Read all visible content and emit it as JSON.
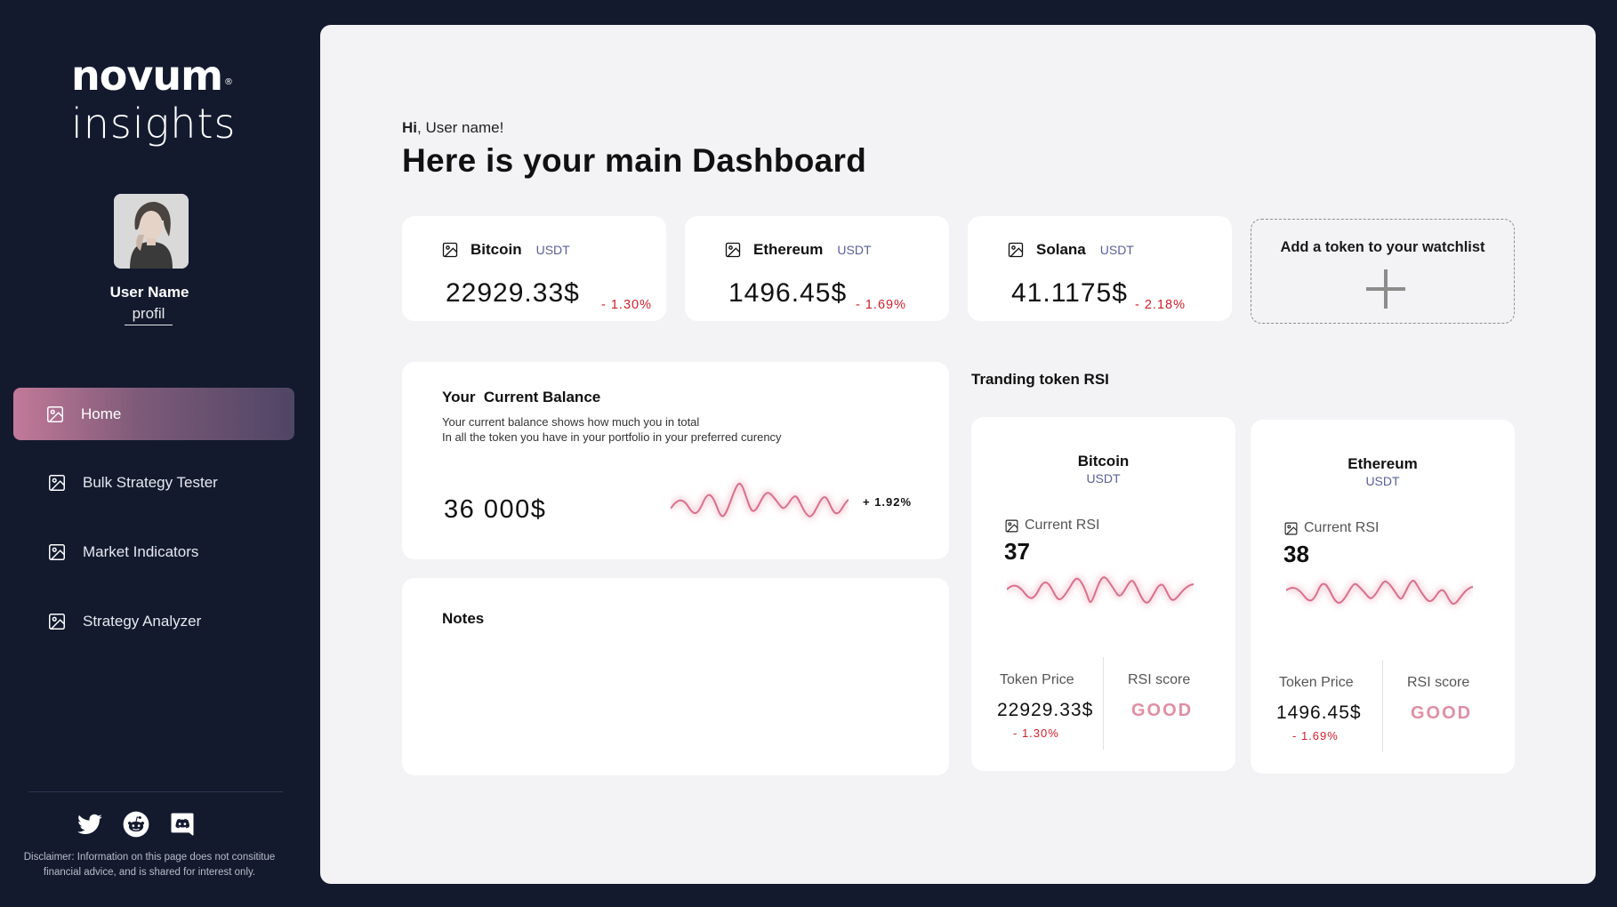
{
  "sidebar": {
    "logo_top": "novum",
    "logo_mark": "®",
    "logo_bottom": "insights",
    "user_name": "User Name",
    "profile_link": "profil",
    "nav": [
      {
        "label": "Home",
        "icon": "image-icon",
        "active": true
      },
      {
        "label": "Bulk Strategy Tester",
        "icon": "image-icon"
      },
      {
        "label": "Market Indicators",
        "icon": "image-icon"
      },
      {
        "label": "Strategy Analyzer",
        "icon": "image-icon"
      }
    ],
    "socials": [
      "twitter-icon",
      "reddit-icon",
      "discord-icon"
    ],
    "disclaimer_line1": "Disclaimer: Information on this page does not consititue",
    "disclaimer_line2": "financial advice, and is shared for interest only."
  },
  "header": {
    "greeting_bold": "Hi",
    "greeting_rest": ", User name!",
    "title": "Here is your main Dashboard"
  },
  "tokens": [
    {
      "name": "Bitcoin",
      "quote": "USDT",
      "price": "22929.33$",
      "change": "- 1.30%"
    },
    {
      "name": "Ethereum",
      "quote": "USDT",
      "price": "1496.45$",
      "change": "- 1.69%"
    },
    {
      "name": "Solana",
      "quote": "USDT",
      "price": "41.1175$",
      "change": "- 2.18%"
    }
  ],
  "watchlist": {
    "add_label": "Add a token to your watchlist"
  },
  "balance": {
    "title": "Your  Current Balance",
    "desc_line1": "Your current balance shows how much you in total",
    "desc_line2": "In all the token you have in your portfolio in your preferred curency",
    "amount": "36 000$",
    "change": "+ 1.92%"
  },
  "notes": {
    "title": "Notes"
  },
  "rsi": {
    "section_title": "Tranding token RSI",
    "cards": [
      {
        "name": "Bitcoin",
        "quote": "USDT",
        "rsi_label": "Current RSI",
        "rsi_value": "37",
        "price_label": "Token Price",
        "price": "22929.33$",
        "change": "- 1.30%",
        "score_label": "RSI score",
        "score": "GOOD"
      },
      {
        "name": "Ethereum",
        "quote": "USDT",
        "rsi_label": "Current RSI",
        "rsi_value": "38",
        "price_label": "Token Price",
        "price": "1496.45$",
        "change": "- 1.69%",
        "score_label": "RSI score",
        "score": "GOOD"
      }
    ]
  },
  "colors": {
    "sidebar_bg": "#131a2e",
    "main_bg": "#f3f3f5",
    "negative": "#d2202b",
    "accent_pink": "#e18ea4",
    "quote_purple": "#5a5f9a"
  }
}
